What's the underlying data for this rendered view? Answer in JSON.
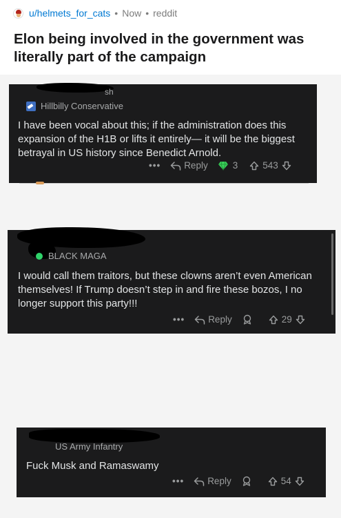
{
  "post": {
    "username": "u/helmets_for_cats",
    "separator": "•",
    "time": "Now",
    "source": "reddit",
    "title": "Elon being involved in the government was literally part of the campaign"
  },
  "comments": [
    {
      "username_fragment": "sh",
      "flair": "Hillbilly Conservative",
      "text": "I have been vocal about this; if the administration does this expansion of the H1B or lifts it entirely— it will be the biggest betrayal in US history since Benedict Arnold.",
      "more": "•••",
      "reply_label": "Reply",
      "award_count": "3",
      "votes": "543"
    },
    {
      "flair": "BLACK MAGA",
      "text": "I would call them traitors, but these clowns aren’t even American themselves! If Trump doesn’t step in and fire these bozos, I no longer support this party!!!",
      "more": "•••",
      "reply_label": "Reply",
      "votes": "29"
    },
    {
      "flair": "US Army Infantry",
      "text": "Fuck Musk and Ramaswamy",
      "more": "•••",
      "reply_label": "Reply",
      "votes": "54"
    }
  ],
  "colors": {
    "accent_link": "#0079d3",
    "card_bg": "#1b1b1c",
    "online_green": "#2fd36a"
  }
}
